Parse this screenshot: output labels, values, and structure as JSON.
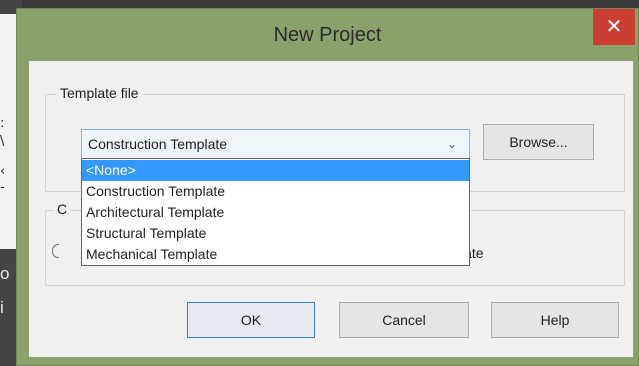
{
  "dialog": {
    "title": "New Project",
    "close_glyph": "✕",
    "template_group": {
      "label": "Template file",
      "selected_value": "Construction Template",
      "arrow_glyph": "⌄",
      "browse_label": "Browse...",
      "options": [
        {
          "label": "<None>",
          "highlighted": true
        },
        {
          "label": "Construction Template",
          "highlighted": false
        },
        {
          "label": "Architectural Template",
          "highlighted": false
        },
        {
          "label": "Structural Template",
          "highlighted": false
        },
        {
          "label": "Mechanical Template",
          "highlighted": false
        }
      ]
    },
    "create_group": {
      "label": "C",
      "partial_text": "late"
    },
    "buttons": {
      "ok": "OK",
      "cancel": "Cancel",
      "help": "Help"
    }
  },
  "background": {
    "glyphs": [
      ":",
      "\\",
      "‹",
      "-"
    ],
    "side_text": [
      "o",
      "i"
    ]
  },
  "colors": {
    "frame": "#89a26b",
    "close_button": "#cc3d33",
    "highlight": "#3399ff"
  }
}
